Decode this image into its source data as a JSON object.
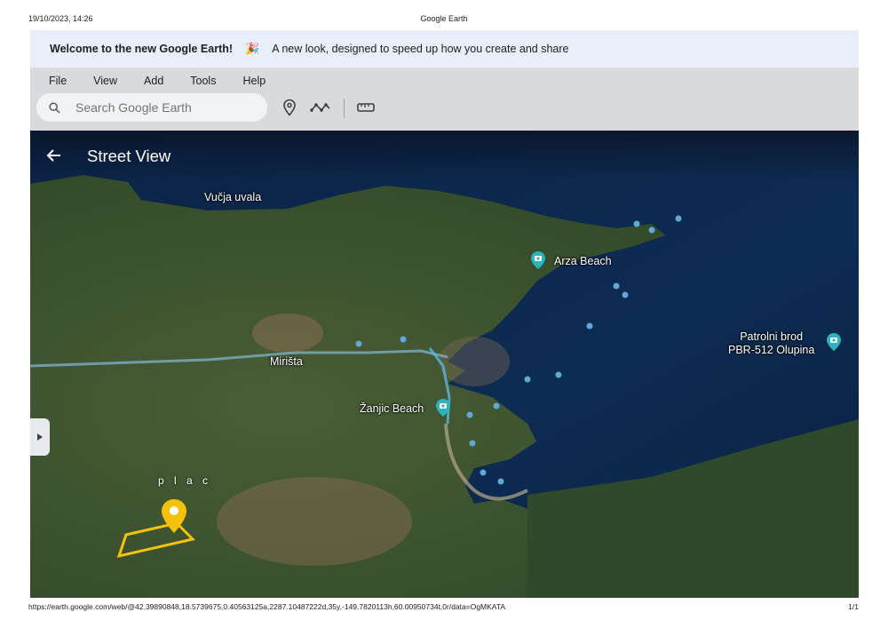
{
  "print_header": {
    "date": "19/10/2023, 14:26",
    "title": "Google Earth"
  },
  "print_footer": {
    "url": "https://earth.google.com/web/@42.39890848,18.5739675,0.40563125a,2287.10487222d,35y,-149.7820113h,60.00950734t,0r/data=OgMKATA",
    "page": "1/1"
  },
  "banner": {
    "title": "Welcome to the new Google Earth!",
    "emoji": "🎉",
    "text": "A new look, designed to speed up how you create and share"
  },
  "menu": [
    "File",
    "View",
    "Add",
    "Tools",
    "Help"
  ],
  "search": {
    "placeholder": "Search Google Earth"
  },
  "toolbar_icons": [
    "search-icon",
    "placemark-icon",
    "path-icon",
    "ruler-icon"
  ],
  "street_view": {
    "title": "Street View"
  },
  "map": {
    "labels": {
      "vucja": "Vučja uvala",
      "arza": "Arza Beach",
      "mirista": "Mirišta",
      "zanjic": "Žanjic Beach",
      "patrol_line1": "Patrolni brod",
      "patrol_line2": "PBR-512 Olupina",
      "plac": "p l a c"
    }
  },
  "colors": {
    "sea": "#0e2a4e",
    "land": "#36502c",
    "banner_bg": "#e8eefa",
    "toolbar_bg": "#d9dadc",
    "pin_teal": "#2bb3c0",
    "marker_yellow": "#f4c20d"
  }
}
